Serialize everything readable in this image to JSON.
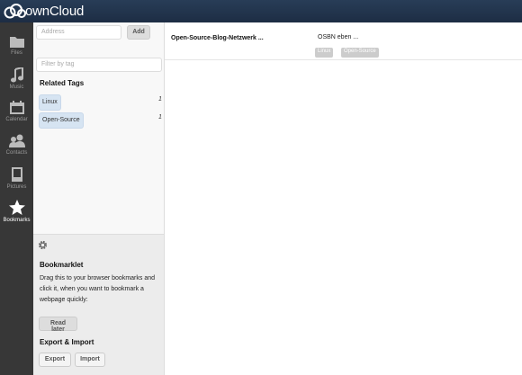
{
  "app": {
    "logo_text": "ownCloud"
  },
  "nav": {
    "items": [
      {
        "label": "Files",
        "icon": "folder-icon"
      },
      {
        "label": "Music",
        "icon": "music-note-icon"
      },
      {
        "label": "Calendar",
        "icon": "calendar-icon"
      },
      {
        "label": "Contacts",
        "icon": "contacts-icon"
      },
      {
        "label": "Pictures",
        "icon": "picture-icon"
      },
      {
        "label": "Bookmarks",
        "icon": "star-icon",
        "active": true
      }
    ]
  },
  "left": {
    "address_placeholder": "Address",
    "add_label": "Add",
    "filter_placeholder": "Filter by tag",
    "related_tags_title": "Related Tags",
    "tags": [
      {
        "name": "Linux",
        "count": "1"
      },
      {
        "name": "Open-Source",
        "count": "1"
      }
    ]
  },
  "settings": {
    "bookmarklet_title": "Bookmarklet",
    "bookmarklet_desc": "Drag this to your browser bookmarks and click it, when you want to bookmark a webpage quickly:",
    "read_later_label": "Read later",
    "export_import_title": "Export & Import",
    "export_label": "Export",
    "import_label": "Import"
  },
  "bookmarks": [
    {
      "title": "Open-Source-Blog-Netzwerk ...",
      "description": "OSBN eben ...",
      "tags": [
        "Linux",
        "Open-Source"
      ]
    }
  ],
  "colors": {
    "header": "#1d2d44",
    "nav": "#373737",
    "tag": "#d6e4f2"
  }
}
